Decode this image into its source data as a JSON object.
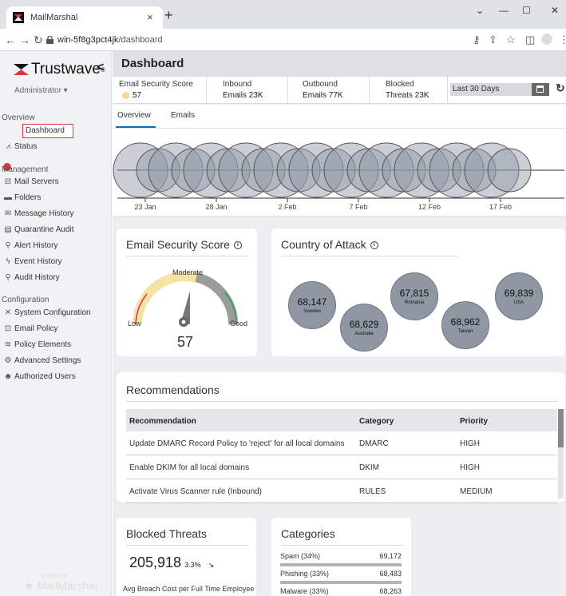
{
  "browser": {
    "tab_title": "MailMarshal",
    "url_host": "win-5f8g3pct4jk",
    "url_path": "/dashboard",
    "new_tab": "+",
    "close_tab": "×"
  },
  "sidebar": {
    "brand": "Trustwave",
    "brand_tm": "®",
    "user_role": "Administrator ▾",
    "sections": [
      "Overview",
      "Management",
      "Configuration"
    ],
    "overview_items": [
      "Dashboard",
      "Status"
    ],
    "management_items": [
      "Mail Servers",
      "Folders",
      "Message History",
      "Quarantine Audit",
      "Alert History",
      "Event History",
      "Audit History"
    ],
    "configuration_items": [
      "System Configuration",
      "Email Policy",
      "Policy Elements",
      "Advanced Settings",
      "Authorized Users"
    ],
    "footer_brand": "MailMarshal",
    "footer_brand_small": "Trustwave"
  },
  "header": {
    "title": "Dashboard",
    "stats": [
      {
        "label": "Email Security Score",
        "value": "57"
      },
      {
        "label": "Inbound",
        "value": "Emails 23K"
      },
      {
        "label": "Outbound",
        "value": "Emails 77K"
      },
      {
        "label": "Blocked",
        "value": "Threats 23K"
      }
    ],
    "date_range": "Last 30 Days"
  },
  "tabs": [
    "Overview",
    "Emails"
  ],
  "timeline": {
    "ticks": [
      "23 Jan",
      "28 Jan",
      "2 Feb",
      "7 Feb",
      "12 Feb",
      "17 Feb"
    ]
  },
  "score_card": {
    "title": "Email Security Score",
    "level": "Moderate",
    "low": "Low",
    "good": "Good",
    "score": "57"
  },
  "country_card": {
    "title": "Country of Attack",
    "countries": [
      {
        "value": "68,147",
        "country": "Sweden"
      },
      {
        "value": "68,629",
        "country": "Australia"
      },
      {
        "value": "67,815",
        "country": "Romania"
      },
      {
        "value": "68,962",
        "country": "Taiwan"
      },
      {
        "value": "69,839",
        "country": "USA"
      }
    ]
  },
  "recommendations": {
    "title": "Recommendations",
    "headers": [
      "Recommendation",
      "Category",
      "Priority"
    ],
    "rows": [
      [
        "Update DMARC Record Policy to 'reject' for all local domains",
        "DMARC",
        "HIGH"
      ],
      [
        "Enable DKIM for all local domains",
        "DKIM",
        "HIGH"
      ],
      [
        "Activate Virus Scanner rule (Inbound)",
        "RULES",
        "MEDIUM"
      ]
    ]
  },
  "blocked": {
    "title": "Blocked Threats",
    "total": "205,918",
    "change": "3.3%",
    "breach_label": "Avg Breach Cost per Full Time Employee"
  },
  "categories": {
    "title": "Categories",
    "items": [
      {
        "label": "Spam (34%)",
        "value": "69,172"
      },
      {
        "label": "Phishing (33%)",
        "value": "68,483"
      },
      {
        "label": "Malware (33%)",
        "value": "68,263"
      }
    ]
  },
  "colors": {
    "accent_red": "#d9363e",
    "tab_underline": "#0a6fb8",
    "bubble_fill": "#8f97a3",
    "gauge_yellow": "#f5e3a6",
    "gauge_grey": "#9b9b9b"
  }
}
